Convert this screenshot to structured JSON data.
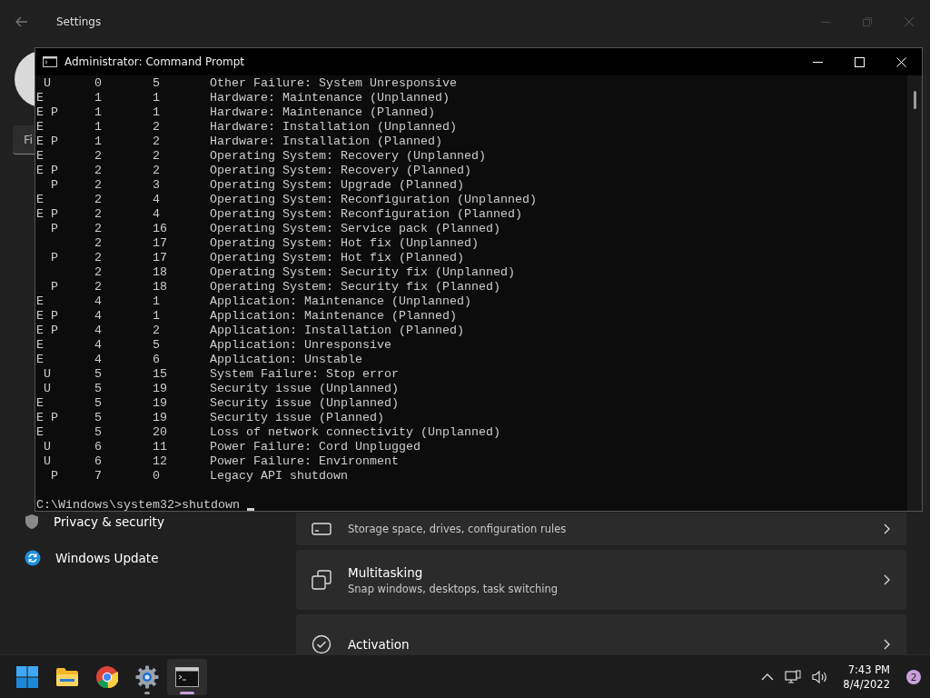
{
  "settings": {
    "title": "Settings",
    "search": {
      "placeholder": "Fi"
    },
    "sidebar": {
      "items": [
        {
          "label": "Privacy & security"
        },
        {
          "label": "Windows Update"
        }
      ]
    },
    "cards": [
      {
        "subtitle": "Storage space, drives, configuration rules"
      },
      {
        "title": "Multitasking",
        "subtitle": "Snap windows, desktops, task switching"
      },
      {
        "title": "Activation"
      }
    ]
  },
  "console": {
    "title": "Administrator: Command Prompt",
    "rows": [
      {
        "flags": " U",
        "major": "0",
        "minor": "5",
        "reason": "Other Failure: System Unresponsive"
      },
      {
        "flags": "E",
        "major": "1",
        "minor": "1",
        "reason": "Hardware: Maintenance (Unplanned)"
      },
      {
        "flags": "E P",
        "major": "1",
        "minor": "1",
        "reason": "Hardware: Maintenance (Planned)"
      },
      {
        "flags": "E",
        "major": "1",
        "minor": "2",
        "reason": "Hardware: Installation (Unplanned)"
      },
      {
        "flags": "E P",
        "major": "1",
        "minor": "2",
        "reason": "Hardware: Installation (Planned)"
      },
      {
        "flags": "E",
        "major": "2",
        "minor": "2",
        "reason": "Operating System: Recovery (Unplanned)"
      },
      {
        "flags": "E P",
        "major": "2",
        "minor": "2",
        "reason": "Operating System: Recovery (Planned)"
      },
      {
        "flags": "  P",
        "major": "2",
        "minor": "3",
        "reason": "Operating System: Upgrade (Planned)"
      },
      {
        "flags": "E",
        "major": "2",
        "minor": "4",
        "reason": "Operating System: Reconfiguration (Unplanned)"
      },
      {
        "flags": "E P",
        "major": "2",
        "minor": "4",
        "reason": "Operating System: Reconfiguration (Planned)"
      },
      {
        "flags": "  P",
        "major": "2",
        "minor": "16",
        "reason": "Operating System: Service pack (Planned)"
      },
      {
        "major": "2",
        "minor": "17",
        "reason": "Operating System: Hot fix (Unplanned)"
      },
      {
        "flags": "  P",
        "major": "2",
        "minor": "17",
        "reason": "Operating System: Hot fix (Planned)"
      },
      {
        "major": "2",
        "minor": "18",
        "reason": "Operating System: Security fix (Unplanned)"
      },
      {
        "flags": "  P",
        "major": "2",
        "minor": "18",
        "reason": "Operating System: Security fix (Planned)"
      },
      {
        "flags": "E",
        "major": "4",
        "minor": "1",
        "reason": "Application: Maintenance (Unplanned)"
      },
      {
        "flags": "E P",
        "major": "4",
        "minor": "1",
        "reason": "Application: Maintenance (Planned)"
      },
      {
        "flags": "E P",
        "major": "4",
        "minor": "2",
        "reason": "Application: Installation (Planned)"
      },
      {
        "flags": "E",
        "major": "4",
        "minor": "5",
        "reason": "Application: Unresponsive"
      },
      {
        "flags": "E",
        "major": "4",
        "minor": "6",
        "reason": "Application: Unstable"
      },
      {
        "flags": " U",
        "major": "5",
        "minor": "15",
        "reason": "System Failure: Stop error"
      },
      {
        "flags": " U",
        "major": "5",
        "minor": "19",
        "reason": "Security issue (Unplanned)"
      },
      {
        "flags": "E",
        "major": "5",
        "minor": "19",
        "reason": "Security issue (Unplanned)"
      },
      {
        "flags": "E P",
        "major": "5",
        "minor": "19",
        "reason": "Security issue (Planned)"
      },
      {
        "flags": "E",
        "major": "5",
        "minor": "20",
        "reason": "Loss of network connectivity (Unplanned)"
      },
      {
        "flags": " U",
        "major": "6",
        "minor": "11",
        "reason": "Power Failure: Cord Unplugged"
      },
      {
        "flags": " U",
        "major": "6",
        "minor": "12",
        "reason": "Power Failure: Environment"
      },
      {
        "flags": "  P",
        "major": "7",
        "minor": "0",
        "reason": "Legacy API shutdown"
      }
    ],
    "prompt": "C:\\Windows\\system32>shutdown"
  },
  "taskbar": {
    "apps": [
      {
        "running": false,
        "selected": false
      },
      {
        "running": false,
        "selected": false
      },
      {
        "running": false,
        "selected": false
      },
      {
        "running": true,
        "selected": false
      },
      {
        "running": true,
        "selected": true
      }
    ],
    "time": "7:43 PM",
    "date": "8/4/2022",
    "badge": "2"
  }
}
